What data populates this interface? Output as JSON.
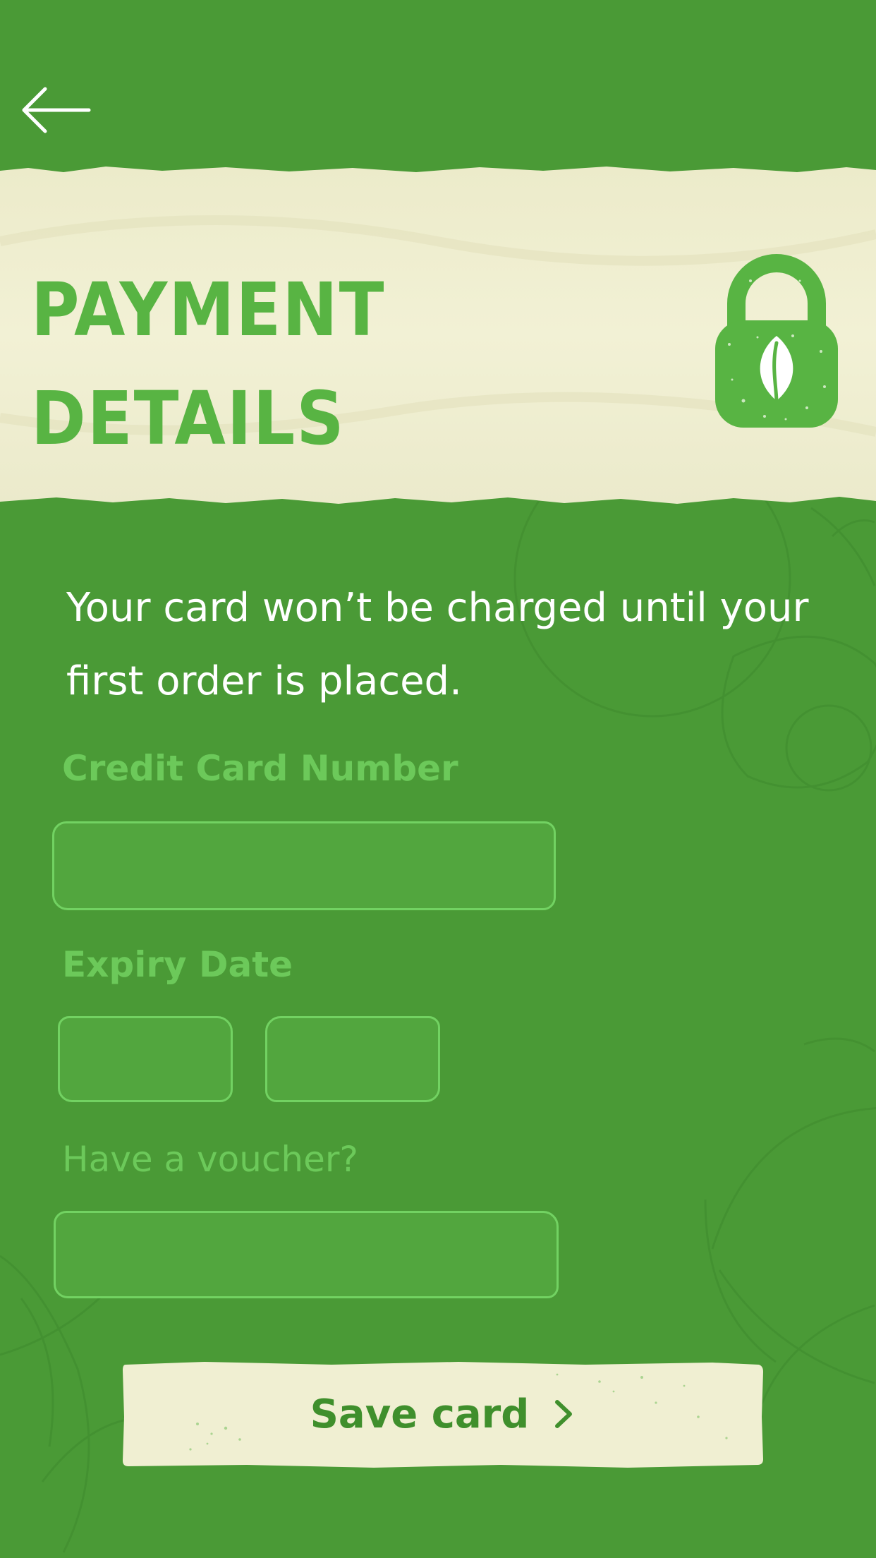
{
  "header": {
    "back_icon": "arrow-left-icon"
  },
  "banner": {
    "title": "PAYMENT\nDETAILS",
    "icon": "padlock-leaf-icon"
  },
  "intro": {
    "text": "Your card won’t be charged until your first order is placed."
  },
  "form": {
    "card_number_label": "Credit Card Number",
    "card_number_value": "",
    "expiry_label": "Expiry Date",
    "expiry_month_value": "",
    "expiry_year_value": "",
    "voucher_label": "Have a voucher?",
    "voucher_value": ""
  },
  "actions": {
    "save_label": "Save card",
    "save_icon": "chevron-right-icon"
  },
  "colors": {
    "background": "#4a9a36",
    "accent": "#58b443",
    "paper": "#f1f0d2",
    "field_border": "#72d262",
    "label": "#6cc95a"
  }
}
